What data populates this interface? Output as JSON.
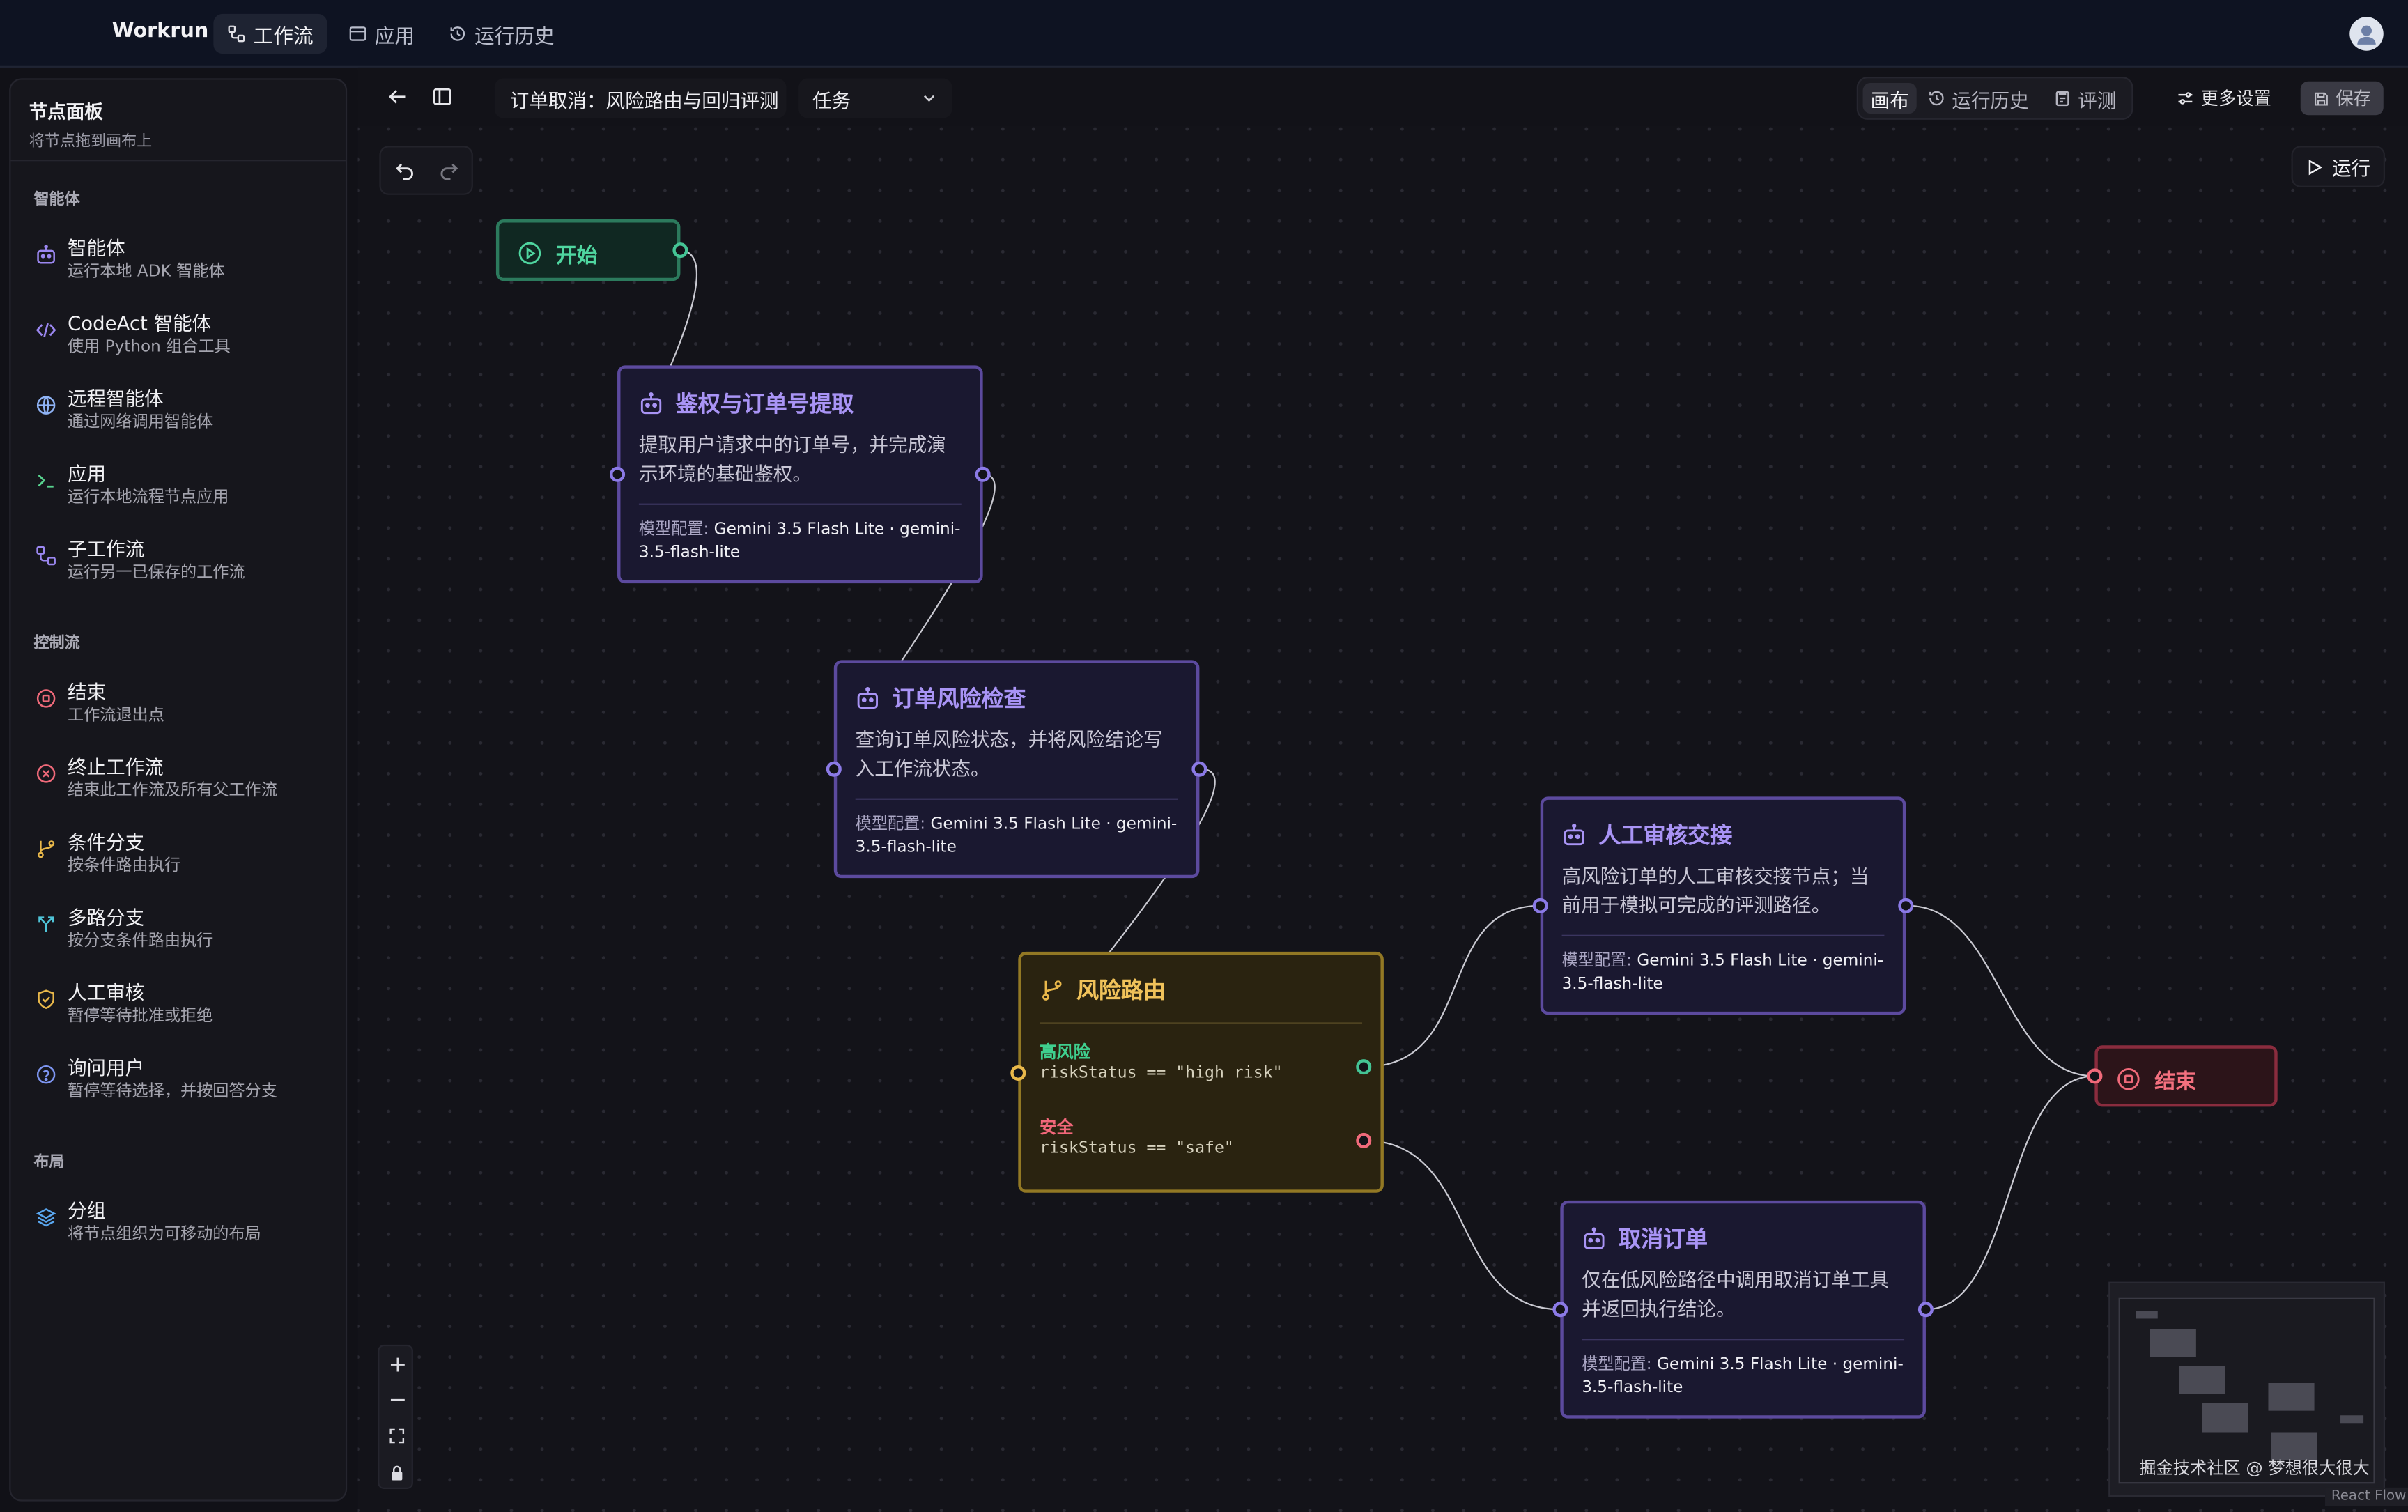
{
  "app": {
    "brand": "Workrun",
    "nav": [
      {
        "label": "工作流",
        "icon": "workflow-icon",
        "active": true
      },
      {
        "label": "应用",
        "icon": "app-window-icon",
        "active": false
      },
      {
        "label": "运行历史",
        "icon": "history-icon",
        "active": false
      }
    ]
  },
  "sidebar": {
    "title": "节点面板",
    "subtitle": "将节点拖到画布上",
    "sections": [
      {
        "label": "智能体",
        "items": [
          {
            "title": "智能体",
            "desc": "运行本地 ADK 智能体",
            "icon": "bot-icon"
          },
          {
            "title": "CodeAct 智能体",
            "desc": "使用 Python 组合工具",
            "icon": "code-icon"
          },
          {
            "title": "远程智能体",
            "desc": "通过网络调用智能体",
            "icon": "globe-icon"
          },
          {
            "title": "应用",
            "desc": "运行本地流程节点应用",
            "icon": "terminal-icon"
          },
          {
            "title": "子工作流",
            "desc": "运行另一已保存的工作流",
            "icon": "subworkflow-icon"
          }
        ]
      },
      {
        "label": "控制流",
        "items": [
          {
            "title": "结束",
            "desc": "工作流退出点",
            "icon": "stop-circle-icon"
          },
          {
            "title": "终止工作流",
            "desc": "结束此工作流及所有父工作流",
            "icon": "x-circle-icon"
          },
          {
            "title": "条件分支",
            "desc": "按条件路由执行",
            "icon": "git-branch-icon"
          },
          {
            "title": "多路分支",
            "desc": "按分支条件路由执行",
            "icon": "split-icon"
          },
          {
            "title": "人工审核",
            "desc": "暂停等待批准或拒绝",
            "icon": "shield-check-icon"
          },
          {
            "title": "询问用户",
            "desc": "暂停等待选择，并按回答分支",
            "icon": "help-circle-icon"
          }
        ]
      },
      {
        "label": "布局",
        "items": [
          {
            "title": "分组",
            "desc": "将节点组织为可移动的布局",
            "icon": "layers-icon"
          }
        ]
      }
    ]
  },
  "toolbar": {
    "workflow_title": "订单取消：风险路由与回归评测",
    "workflow_type": "任务",
    "view_tabs": [
      {
        "label": "画布",
        "active": true
      },
      {
        "label": "运行历史",
        "active": false
      },
      {
        "label": "评测",
        "active": false
      }
    ],
    "more_settings": "更多设置",
    "save": "保存",
    "run": "运行"
  },
  "nodes": {
    "start": {
      "title": "开始"
    },
    "auth": {
      "title": "鉴权与订单号提取",
      "desc": "提取用户请求中的订单号，并完成演示环境的基础鉴权。",
      "model_label": "模型配置:",
      "model": "Gemini 3.5 Flash Lite · gemini-3.5-flash-lite"
    },
    "risk_check": {
      "title": "订单风险检查",
      "desc": "查询订单风险状态，并将风险结论写入工作流状态。",
      "model_label": "模型配置:",
      "model": "Gemini 3.5 Flash Lite · gemini-3.5-flash-lite"
    },
    "router": {
      "title": "风险路由",
      "branches": [
        {
          "label": "高风险",
          "expr": "riskStatus == \"high_risk\"",
          "color": "#3fcf8e"
        },
        {
          "label": "安全",
          "expr": "riskStatus == \"safe\"",
          "color": "#f2677a"
        }
      ]
    },
    "handoff": {
      "title": "人工审核交接",
      "desc": "高风险订单的人工审核交接节点；当前用于模拟可完成的评测路径。",
      "model_label": "模型配置:",
      "model": "Gemini 3.5 Flash Lite · gemini-3.5-flash-lite"
    },
    "cancel": {
      "title": "取消订单",
      "desc": "仅在低风险路径中调用取消订单工具并返回执行结论。",
      "model_label": "模型配置:",
      "model": "Gemini 3.5 Flash Lite · gemini-3.5-flash-lite"
    },
    "end": {
      "title": "结束"
    }
  },
  "footer": {
    "watermark": "掘金技术社区 @ 梦想很大很大",
    "attribution": "React Flow"
  },
  "colors": {
    "agent_accent": "#a994f5",
    "start_accent": "#44c495",
    "end_accent": "#f06a7a",
    "router_accent": "#e9b84a"
  }
}
